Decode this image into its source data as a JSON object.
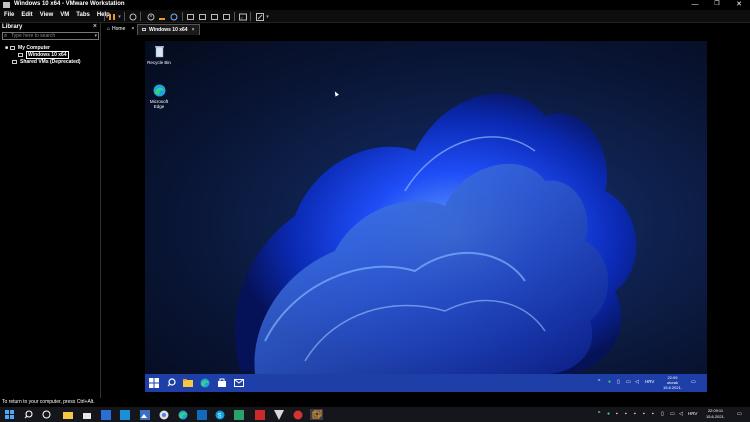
{
  "window": {
    "title": "Windows 10 x64 - VMware Workstation",
    "minimize": "—",
    "restore": "❐",
    "close": "✕"
  },
  "menu": [
    "File",
    "Edit",
    "View",
    "VM",
    "Tabs",
    "Help"
  ],
  "library": {
    "header": "Library",
    "close": "×",
    "search_placeholder": "Type here to search",
    "tree": {
      "my_computer": "My Computer",
      "vm": "Windows 10 x64",
      "shared": "Shared VMs (Deprecated)"
    }
  },
  "tabs": [
    {
      "label": "Home",
      "close": "×"
    },
    {
      "label": "Windows 10 x64",
      "close": "×"
    }
  ],
  "guest": {
    "desktop_icons": [
      {
        "label": "Recycle Bin",
        "icon": "recycle-bin-icon"
      },
      {
        "label": "Microsoft Edge",
        "icon": "edge-icon"
      }
    ],
    "taskbar": {
      "lang": "HRV",
      "clock_time": "22:09",
      "clock_day": "utorak",
      "clock_date": "15.6.2021."
    }
  },
  "status": {
    "message": "To return to your computer, press Ctrl+Alt."
  },
  "host_taskbar": {
    "lang": "HRV",
    "clock_time": "22:09:11",
    "clock_date": "15.6.2021."
  },
  "colors": {
    "guest_taskbar": "#1e3fa8",
    "bloom": "#1f4fff"
  }
}
